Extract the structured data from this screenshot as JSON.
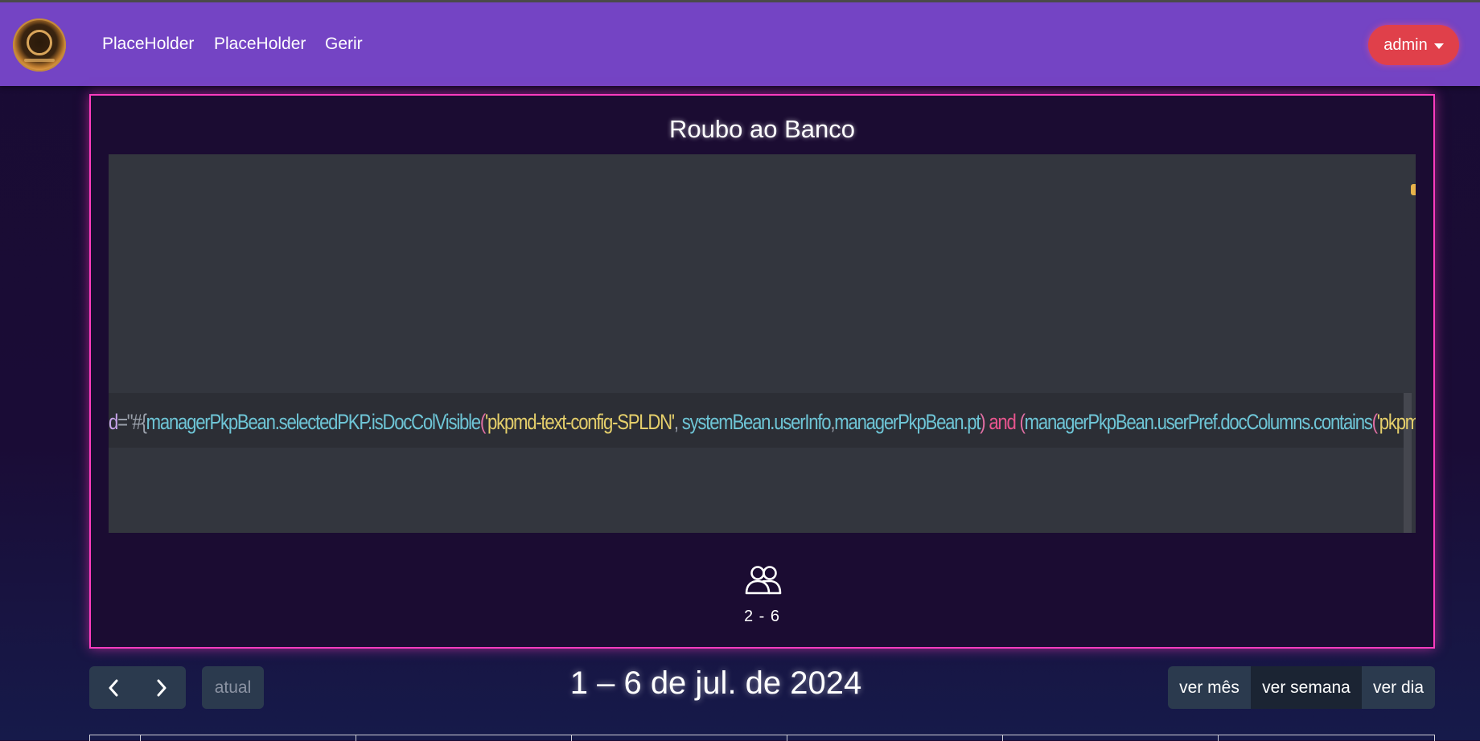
{
  "navbar": {
    "links": [
      "PlaceHolder",
      "PlaceHolder",
      "Gerir"
    ],
    "user_menu_label": "admin",
    "logo_icon": "emblem-logo",
    "accent_color": "#7444c4"
  },
  "card": {
    "title": "Roubo ao Banco",
    "image": {
      "code_tokens": [
        {
          "t": "d",
          "c": "c-attr"
        },
        {
          "t": "=\"#{",
          "c": "c-op"
        },
        {
          "t": "managerPkpBean.selectedPKP.isDocColVisible",
          "c": "c-id"
        },
        {
          "t": "(",
          "c": "c-par"
        },
        {
          "t": "'pkpmd-text-config-SPLDN'",
          "c": "c-str"
        },
        {
          "t": ", ",
          "c": "c-op"
        },
        {
          "t": "systemBean.userInfo",
          "c": "c-id"
        },
        {
          "t": ",",
          "c": "c-op"
        },
        {
          "t": "managerPkpBean.pt",
          "c": "c-id"
        },
        {
          "t": ")",
          "c": "c-par"
        },
        {
          "t": " and ",
          "c": "c-kw"
        },
        {
          "t": "(",
          "c": "c-par"
        },
        {
          "t": "managerPkpBean.userPref.docColumns.contains",
          "c": "c-id"
        },
        {
          "t": "(",
          "c": "c-par"
        },
        {
          "t": "'pkpmd-text-config-SPLDN'",
          "c": "c-str"
        },
        {
          "t": "))",
          "c": "c-par"
        },
        {
          "t": "}\"",
          "c": "c-op"
        },
        {
          "t": ">",
          "c": "c-kw"
        }
      ]
    },
    "players_icon": "users-icon",
    "players": "2 - 6",
    "border_color": "#ff3cbf"
  },
  "calendar": {
    "prev_icon": "chevron-left-icon",
    "next_icon": "chevron-right-icon",
    "today_label": "atual",
    "range_title": "1 – 6 de jul. de 2024",
    "views": [
      {
        "label": "ver mês",
        "active": false
      },
      {
        "label": "ver semana",
        "active": true
      },
      {
        "label": "ver dia",
        "active": false
      }
    ]
  }
}
